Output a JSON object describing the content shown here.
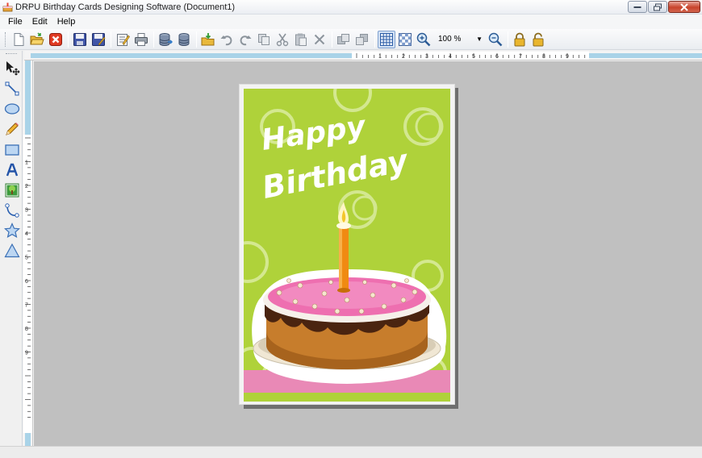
{
  "window": {
    "title": "DRPU Birthday Cards Designing Software  (Document1)"
  },
  "menu": {
    "items": [
      "File",
      "Edit",
      "Help"
    ]
  },
  "toolbar": {
    "icons": [
      "new-document-icon",
      "open-folder-icon",
      "close-document-icon",
      "save-icon",
      "save-as-icon",
      "properties-icon",
      "print-icon",
      "database-export-icon",
      "database-icon",
      "import-icon",
      "undo-icon",
      "redo-icon",
      "copy-format-icon",
      "cut-icon",
      "paste-icon",
      "delete-icon",
      "bring-forward-icon",
      "send-backward-icon",
      "grid-icon",
      "transparency-icon",
      "zoom-in-icon",
      "zoom-out-icon",
      "lock-icon",
      "unlock-icon"
    ],
    "zoom_value": "100 %"
  },
  "tools": {
    "icons": [
      "pointer-icon",
      "line-icon",
      "ellipse-icon",
      "pencil-icon",
      "rectangle-icon",
      "text-icon",
      "picture-icon",
      "curve-icon",
      "star-icon",
      "triangle-icon"
    ]
  },
  "rulers": {
    "top_numbers": [
      "1",
      "2",
      "3",
      "4",
      "5",
      "6",
      "7",
      "8",
      "9"
    ],
    "left_numbers": [
      "1",
      "2",
      "3",
      "4",
      "5",
      "6",
      "7",
      "8",
      "9"
    ]
  },
  "card": {
    "line1": "Happy",
    "line2": "Birthday",
    "colors": {
      "background": "#afd23a",
      "stripe": "#e989b6",
      "frosting": "#ee6fb0",
      "cake": "#c77d2c",
      "chocolate": "#4a2410",
      "candle": "#f08a12",
      "circle": "#d8ea9a"
    }
  }
}
